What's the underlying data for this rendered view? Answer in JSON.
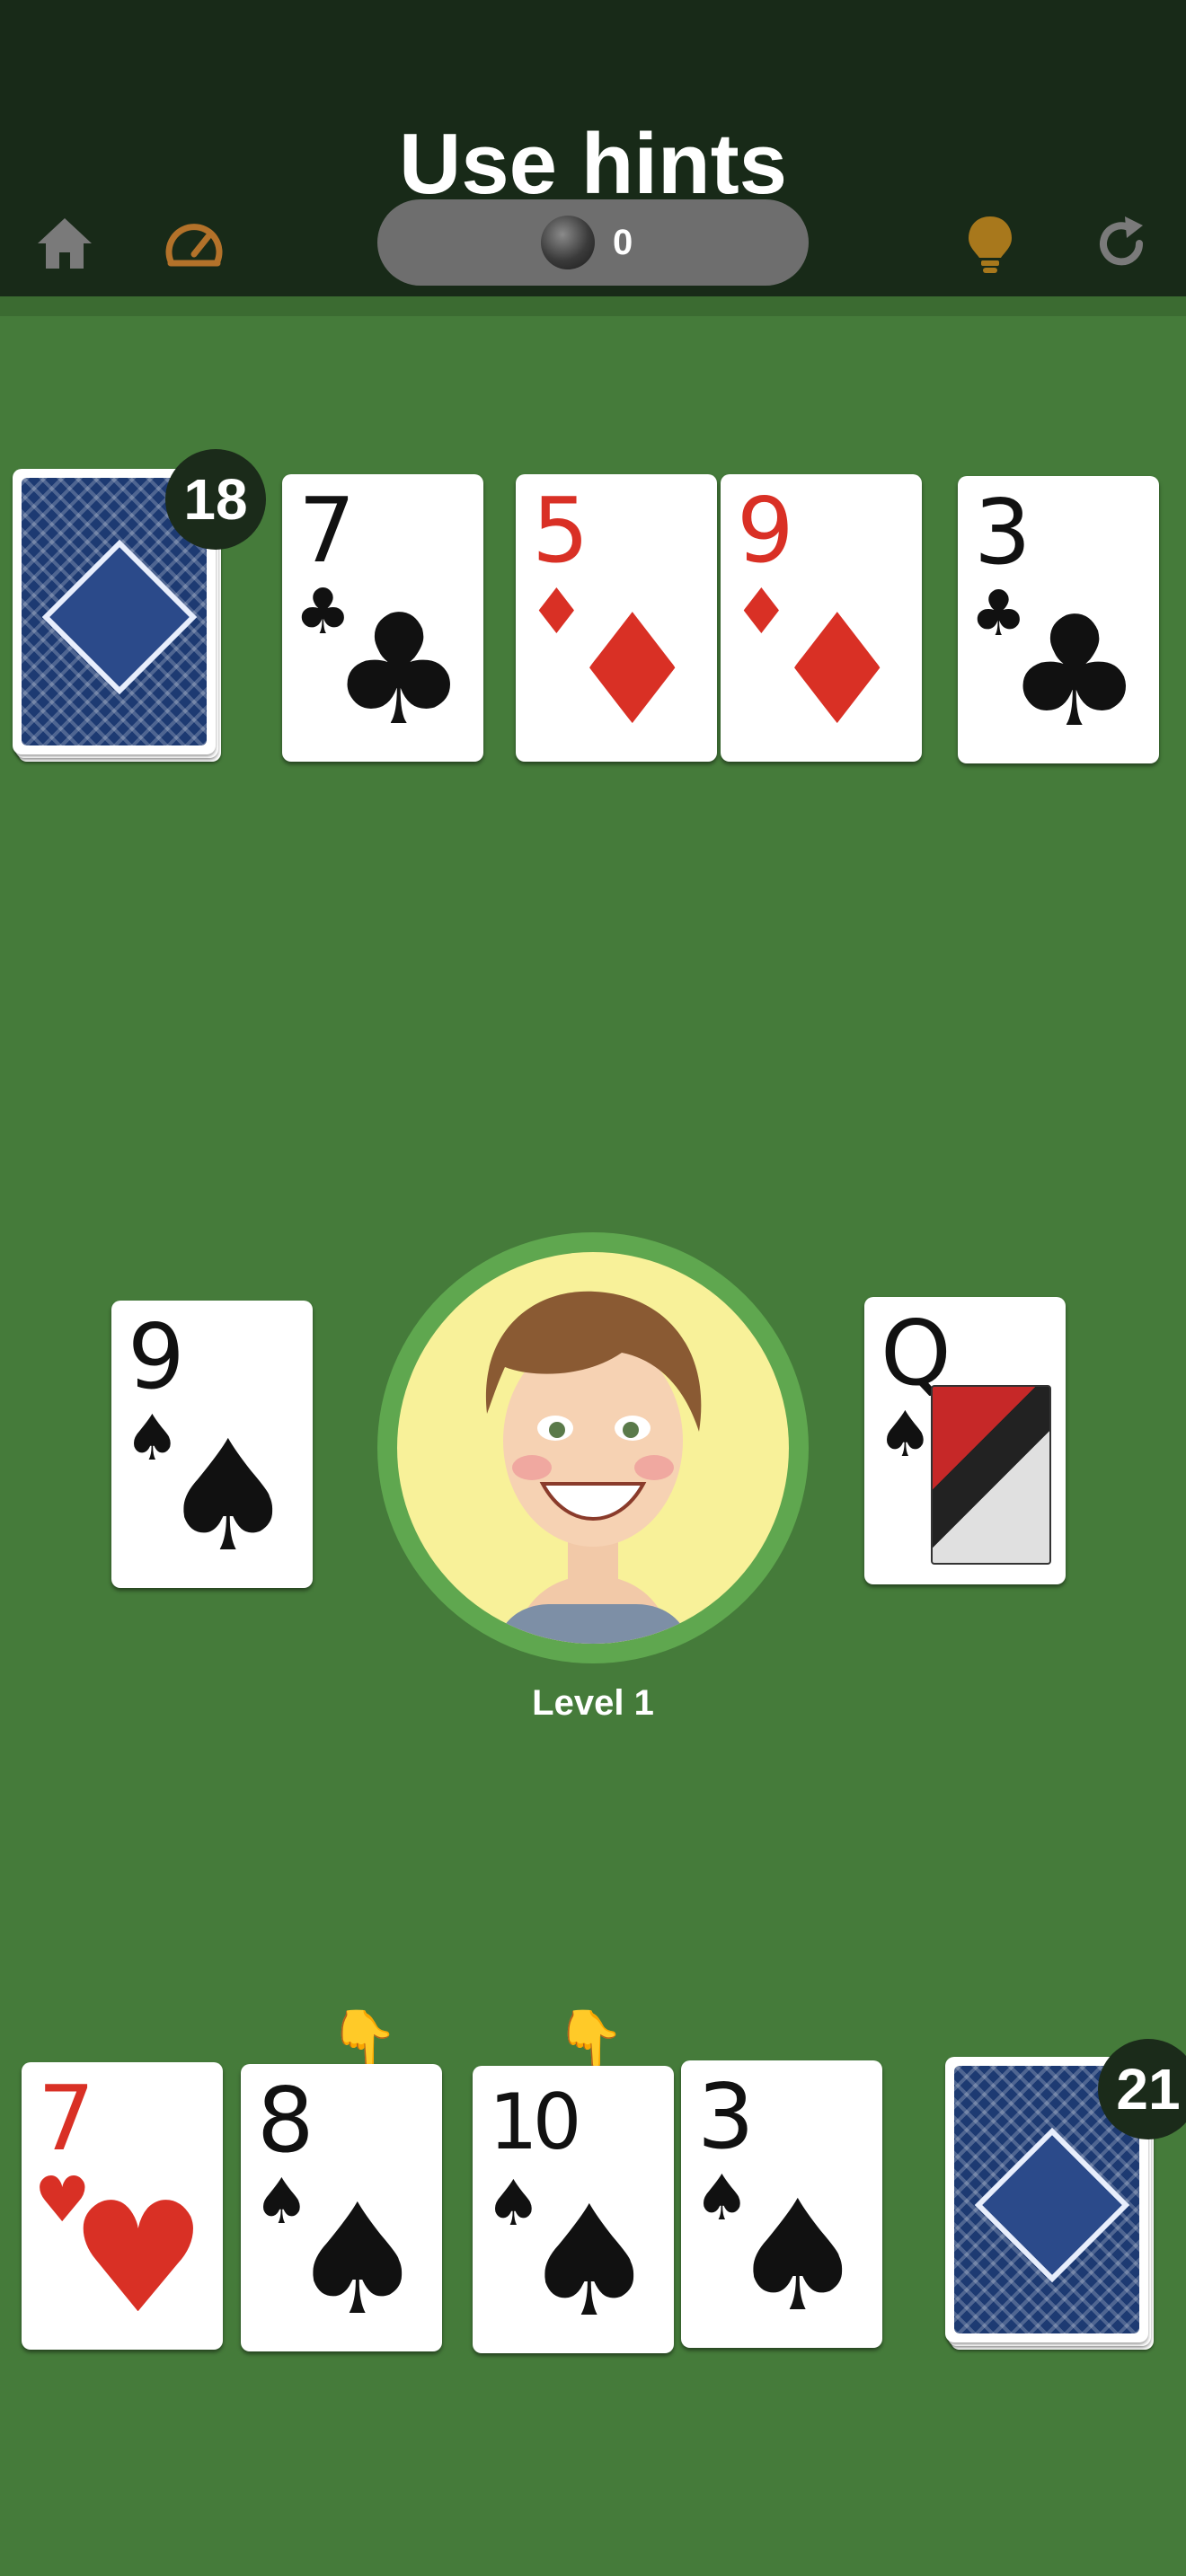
{
  "header": {
    "title": "Use hints",
    "coins": "0",
    "icons": [
      "home-icon",
      "speedometer-icon",
      "coin-icon",
      "lightbulb-icon",
      "restart-icon"
    ],
    "colors": {
      "home": "#7a7a7a",
      "speed": "#b3722a",
      "bulb": "#a8781c",
      "restart": "#7a7a7a"
    }
  },
  "opponent": {
    "deck_count": "18",
    "cards": [
      {
        "rank": "7",
        "suit": "♣",
        "color": "black"
      },
      {
        "rank": "5",
        "suit": "♦",
        "color": "red"
      },
      {
        "rank": "9",
        "suit": "♦",
        "color": "red"
      },
      {
        "rank": "3",
        "suit": "♣",
        "color": "black"
      }
    ]
  },
  "table": {
    "left_card": {
      "rank": "9",
      "suit": "♠",
      "color": "black"
    },
    "right_card": {
      "rank": "Q",
      "suit": "♠",
      "color": "black"
    },
    "level": "Level 1"
  },
  "player": {
    "deck_count": "21",
    "cards": [
      {
        "rank": "7",
        "suit": "♥",
        "color": "red",
        "hint": false
      },
      {
        "rank": "8",
        "suit": "♠",
        "color": "black",
        "hint": true
      },
      {
        "rank": "10",
        "suit": "♠",
        "color": "black",
        "hint": true
      },
      {
        "rank": "3",
        "suit": "♠",
        "color": "black",
        "hint": false
      }
    ],
    "hint_symbol": "👇"
  }
}
